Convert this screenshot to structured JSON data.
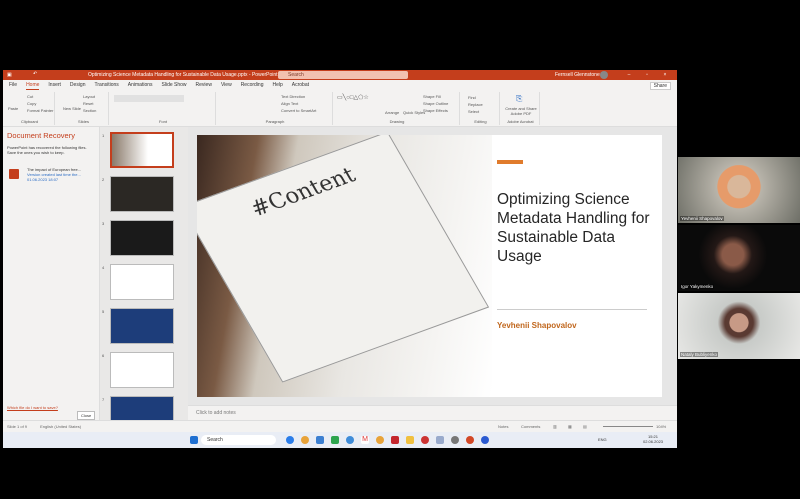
{
  "window": {
    "title": "Optimizing Science Metadata Handling for Sustainable Data Usage.pptx - PowerPoint",
    "search": "Search",
    "user": "Fernsell Glennstone",
    "share": "Share"
  },
  "tabs": [
    "File",
    "Home",
    "Insert",
    "Design",
    "Transitions",
    "Animations",
    "Slide Show",
    "Review",
    "View",
    "Recording",
    "Help",
    "Acrobat"
  ],
  "ribbon": {
    "clipboard": {
      "label": "Clipboard",
      "paste": "Paste",
      "cut": "Cut",
      "copy": "Copy",
      "format_painter": "Format Painter"
    },
    "slides": {
      "label": "Slides",
      "new_slide": "New Slide",
      "layout": "Layout",
      "reset": "Reset",
      "section": "Section"
    },
    "font": {
      "label": "Font"
    },
    "paragraph": {
      "label": "Paragraph",
      "text_direction": "Text Direction",
      "align_text": "Align Text",
      "convert": "Convert to SmartArt"
    },
    "drawing": {
      "label": "Drawing",
      "arrange": "Arrange",
      "quick_styles": "Quick Styles",
      "shape_fill": "Shape Fill",
      "shape_outline": "Shape Outline",
      "shape_effects": "Shape Effects"
    },
    "editing": {
      "label": "Editing",
      "find": "Find",
      "replace": "Replace",
      "select": "Select"
    },
    "acrobat": {
      "label": "Adobe Acrobat",
      "create": "Create and Share Adobe PDF"
    }
  },
  "recovery": {
    "title": "Document Recovery",
    "message": "PowerPoint has recovered the following files. Save the ones you wish to keep.",
    "file_name": "The impact of European free...",
    "file_status": "Version created last time the...",
    "file_date": "01.06.2023 18:07",
    "help_link": "Which file do I want to save?",
    "close": "Close"
  },
  "thumbnails": [
    "1",
    "2",
    "3",
    "4",
    "5",
    "6",
    "7"
  ],
  "slide": {
    "title": "Optimizing Science Metadata Handling for Sustainable Data Usage",
    "author": "Yevhenii Shapovalov",
    "image_text": "#Content",
    "accent": "#e07b2c"
  },
  "notes_placeholder": "Click to add notes",
  "status": {
    "slide": "Slide 1 of 9",
    "language": "English (United States)",
    "notes": "Notes",
    "comments": "Comments",
    "zoom": "104%"
  },
  "taskbar": {
    "search": "Search",
    "lang": "ENG",
    "time": "15:21",
    "date": "02.06.2023"
  },
  "participants": [
    {
      "name": "Yevhenii Shapovalov"
    },
    {
      "name": "Igor Yakymenko"
    },
    {
      "name": "Nataly Bubliyenko"
    }
  ],
  "colors": {
    "brand": "#c43e1c"
  }
}
